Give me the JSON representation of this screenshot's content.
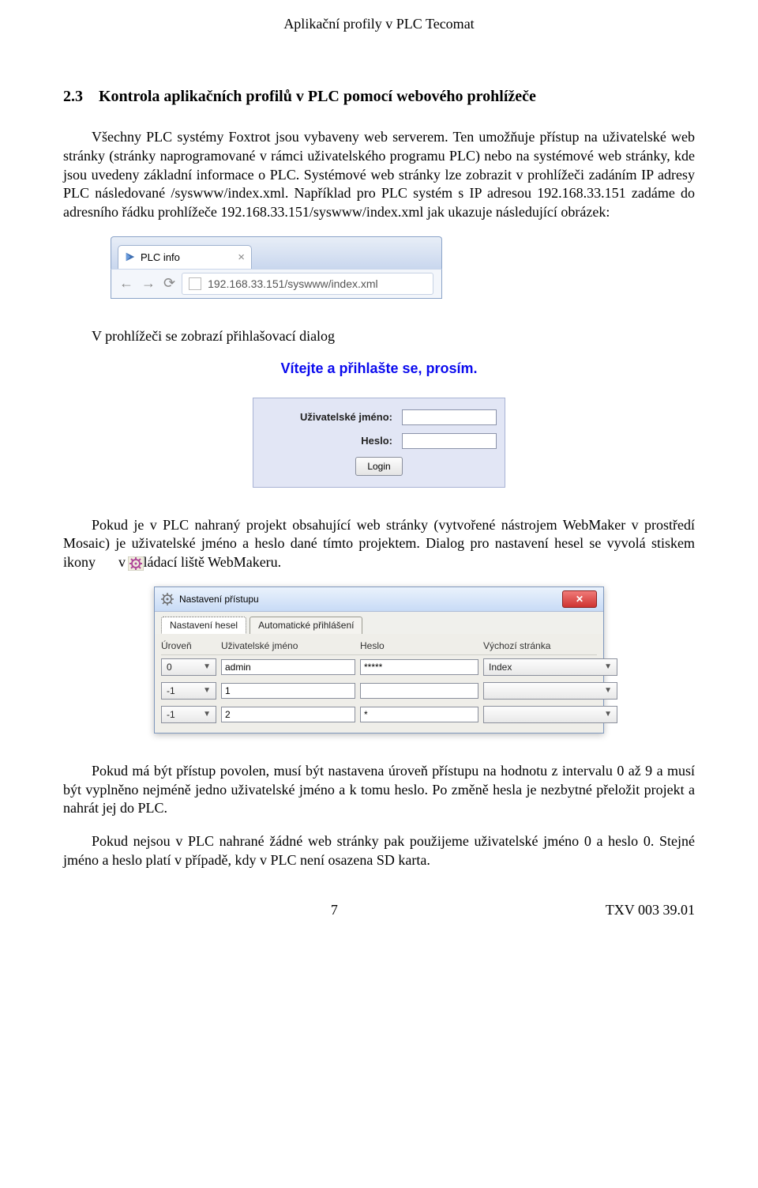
{
  "header": "Aplikační profily v PLC Tecomat",
  "section": {
    "number": "2.3",
    "title": "Kontrola aplikačních profilů v PLC pomocí webového prohlížeče"
  },
  "paragraphs": {
    "p1": "Všechny PLC systémy Foxtrot jsou vybaveny web serverem. Ten umožňuje přístup na uživatelské web stránky (stránky naprogramované v rámci uživatelského programu PLC) nebo na systémové web stránky, kde jsou uvedeny základní informace o PLC. Systémové web stránky lze zobrazit v prohlížeči zadáním IP adresy PLC následované /syswww/index.xml. Například pro PLC systém s IP adresou 192.168.33.151 zadáme do adresního řádku prohlížeče 192.168.33.151/syswww/index.xml jak ukazuje následující obrázek:",
    "p2": "V prohlížeči se zobrazí přihlašovací dialog",
    "p3_a": "Pokud je v PLC nahraný projekt obsahující web stránky (vytvořené nástrojem WebMaker v prostředí Mosaic) je uživatelské jméno a heslo dané tímto projektem. Dialog pro nastavení hesel se vyvolá  stiskem  ikony",
    "p3_b": "v ovládací liště WebMakeru.",
    "p4": "Pokud má být přístup povolen, musí být nastavena úroveň přístupu na hodnotu z intervalu 0 až 9 a musí být vyplněno nejméně jedno uživatelské jméno a k tomu heslo. Po změně hesla je nezbytné přeložit projekt a nahrát jej do PLC.",
    "p5": "Pokud nejsou v PLC nahrané žádné web stránky pak použijeme uživatelské jméno 0 a heslo 0. Stejné jméno a heslo platí v případě, kdy v PLC není osazena SD karta."
  },
  "browser": {
    "tab_label": "PLC info",
    "url": "192.168.33.151/syswww/index.xml"
  },
  "login": {
    "title": "Vítejte a přihlašte se, prosím.",
    "user_label": "Uživatelské jméno:",
    "pass_label": "Heslo:",
    "button": "Login"
  },
  "settings": {
    "window_title": "Nastavení přístupu",
    "tabs": [
      "Nastavení hesel",
      "Automatické přihlášení"
    ],
    "headers": [
      "Úroveň",
      "Uživatelské jméno",
      "Heslo",
      "Výchozí stránka"
    ],
    "rows": [
      {
        "level": "0",
        "user": "admin",
        "pass": "*****",
        "page": "Index"
      },
      {
        "level": "-1",
        "user": "1",
        "pass": "",
        "page": ""
      },
      {
        "level": "-1",
        "user": "2",
        "pass": "*",
        "page": ""
      }
    ]
  },
  "footer": {
    "page": "7",
    "doc": "TXV 003 39.01"
  }
}
